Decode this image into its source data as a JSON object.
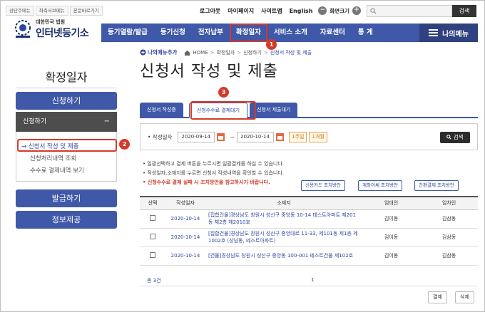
{
  "util_links": [
    "상단주메뉴",
    "좌측서브메뉴",
    "본문바로가기"
  ],
  "top": {
    "logout": "로그아웃",
    "mypage": "마이페이지",
    "sitemap": "사이트맵",
    "english": "English",
    "zoom_out": "−",
    "zoom_label": "화면크기",
    "zoom_in": "+",
    "search_placeholder": "",
    "search_button": "검색"
  },
  "logo": {
    "small": "대한민국 법원",
    "big": "인터넷등기소"
  },
  "gnb": {
    "items": [
      "등기열람/발급",
      "등기신청",
      "전자납부",
      "확정일자",
      "서비스 소개",
      "자료센터",
      "통 계"
    ],
    "mymenu": "나의메뉴"
  },
  "markers": [
    "1",
    "2",
    "3"
  ],
  "lnb": {
    "title": "확정일자",
    "apply_button": "신청하기",
    "sub_header": "신청하기",
    "sub_toggle": "−",
    "links": [
      "→ 신청서 작성 및 제출",
      "신청처리내역 조회",
      "수수료 결제내역 보기"
    ],
    "issue_button": "발급하기",
    "info_button": "정보제공"
  },
  "breadcrumb": {
    "mymenu_add": "나의메뉴추가",
    "items": [
      "HOME",
      "확정일자",
      "신청하기",
      "신청서 작성 및 제출"
    ]
  },
  "page_title": "신청서 작성 및 제출",
  "tabs": [
    "신청서 작성중",
    "신청수수료 결제대기",
    "신청서 제출대기"
  ],
  "filter": {
    "label": "• 작성일자",
    "date_from": "2020-09-14",
    "tilde": "~",
    "date_to": "2020-10-14",
    "period_1": "1주일",
    "period_2": "1개월",
    "search_button": "검색"
  },
  "notes": [
    "• 일괄선택하고 결제 버튼을 누르시면 일괄결제를 하실 수 있습니다.",
    "• 작성일자,소재지를 누르면 신청서 작성내역을 확인할 수 있습니다.",
    "• 신청수수료 결제 실패 시 조치방안을 참고하시기 바랍니다."
  ],
  "guide_buttons": [
    "신용카드 조치방안",
    "계좌이체 조치방안",
    "간편결제 조치방안"
  ],
  "table": {
    "headers": [
      "선택",
      "작성일자",
      "소재지",
      "임대인",
      "임차인"
    ],
    "rows": [
      {
        "date": "2020-10-14",
        "address": "[집합건물]경상남도 창원시 성산구 중앙동 10-14 테스트아파트 제201동 제2층 제2010호",
        "lessor": "김이동",
        "lessee": "김삼동"
      },
      {
        "date": "2020-10-14",
        "address": "[집합건물]경상남도 창원시 성산구 중앙대로 11-33, 제101동 제1층 제1002호 (상남동, 테스트아파트)",
        "lessor": "김이동",
        "lessee": "김삼동"
      },
      {
        "date": "2020-10-14",
        "address": "[건물]경상남도 창원시 성산구 중앙동 100-001 테스트건물 제102호",
        "lessor": "김이동",
        "lessee": "김삼동"
      }
    ]
  },
  "summary": {
    "total": "총 3건",
    "page": "1"
  },
  "actions": {
    "pay": "결제",
    "delete": "삭제"
  },
  "colors": {
    "primary": "#3f58a8",
    "highlight": "#d43a2a",
    "period": "#c97a12"
  }
}
